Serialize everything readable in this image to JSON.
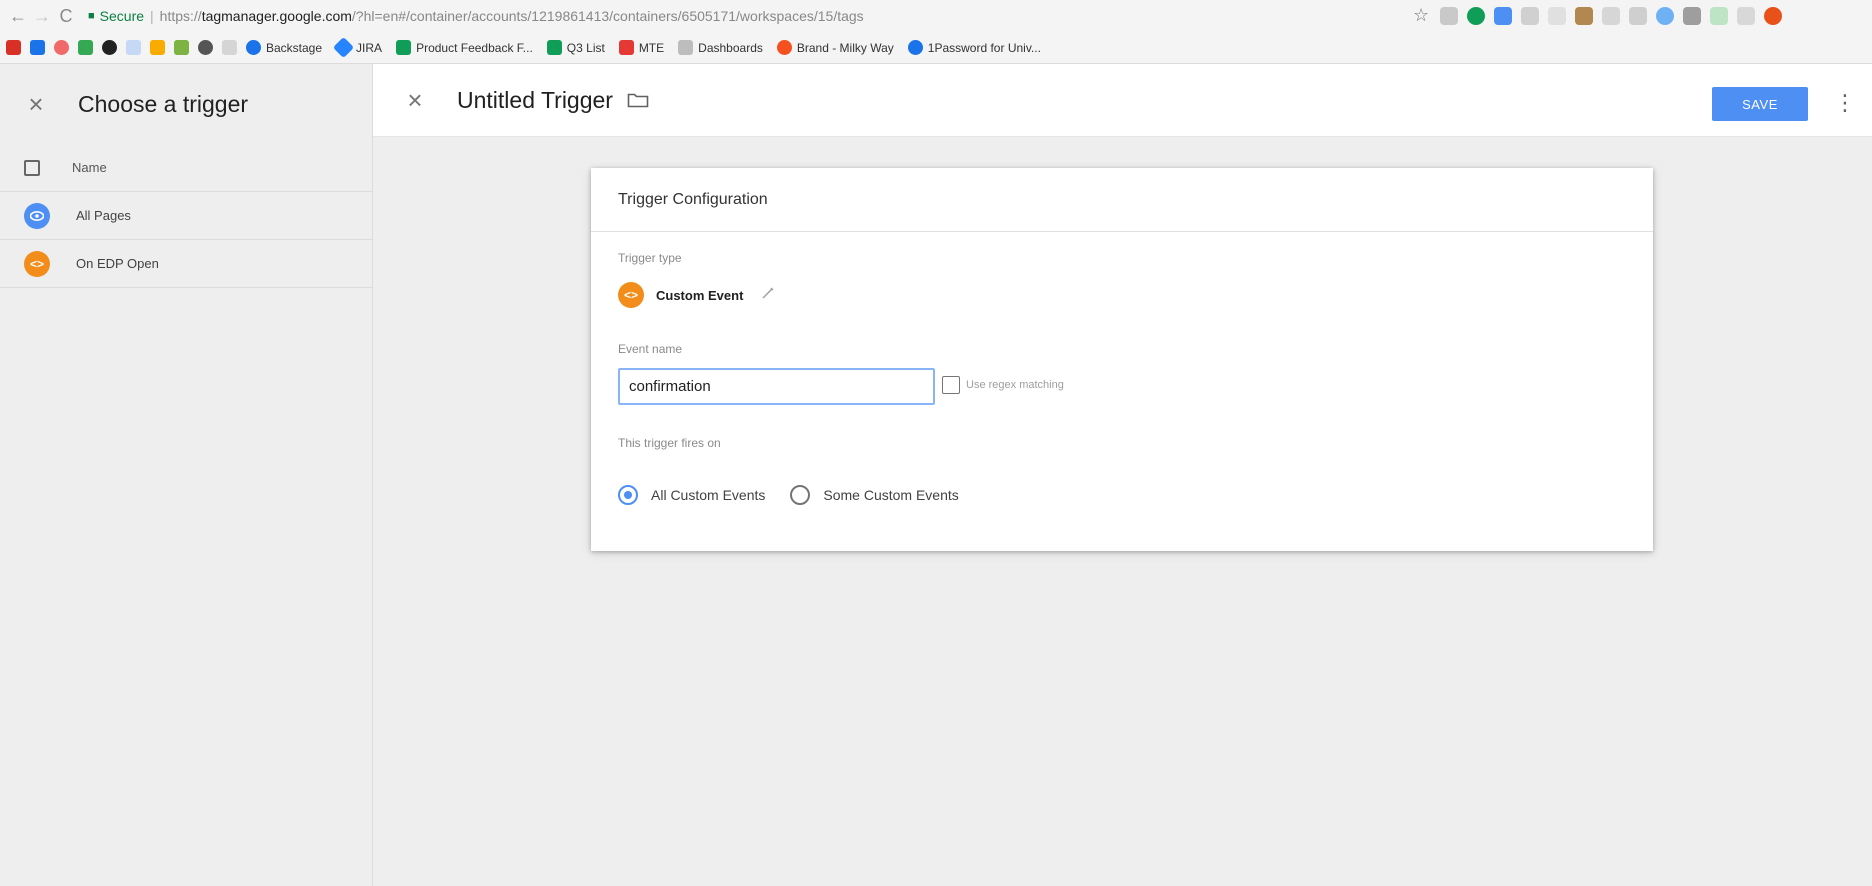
{
  "browser": {
    "back": "←",
    "forward": "→",
    "reload": "C",
    "secure_label": "Secure",
    "url_scheme": "https://",
    "url_host": "tagmanager.google.com",
    "url_path": "/?hl=en#/container/accounts/1219861413/containers/6505171/workspaces/15/tags",
    "bookmark_star": "☆"
  },
  "bookmarks": [
    {
      "label": "Backstage",
      "color": "#1a73e8"
    },
    {
      "label": "JIRA",
      "color": "#2684ff"
    },
    {
      "label": "Product Feedback F...",
      "color": "#0f9d58"
    },
    {
      "label": "Q3 List",
      "color": "#0f9d58"
    },
    {
      "label": "MTE",
      "color": "#e53935"
    },
    {
      "label": "Dashboards",
      "color": "#9e9e9e"
    },
    {
      "label": "Brand - Milky Way",
      "color": "#f4511e"
    },
    {
      "label": "1Password for Univ...",
      "color": "#1a73e8"
    }
  ],
  "left_panel": {
    "close_icon": "×",
    "title": "Choose a trigger",
    "header_label": "Name",
    "triggers": [
      {
        "label": "All Pages",
        "icon": "eye-icon",
        "color": "#4d8ff3"
      },
      {
        "label": "On EDP Open",
        "icon": "code-icon",
        "color": "#f28c1a"
      }
    ]
  },
  "editor": {
    "close_icon": "×",
    "title": "Untitled Trigger",
    "save_label": "SAVE",
    "more_icon": "⋮",
    "card": {
      "heading": "Trigger Configuration",
      "trigger_type_label": "Trigger type",
      "trigger_type_value": "Custom Event",
      "trigger_type_color": "#f28c1a",
      "event_name_label": "Event name",
      "event_name_value": "confirmation",
      "regex_label": "Use regex matching",
      "regex_checked": false,
      "fires_on_label": "This trigger fires on",
      "options": [
        {
          "label": "All Custom Events",
          "selected": true
        },
        {
          "label": "Some Custom Events",
          "selected": false
        }
      ]
    }
  },
  "colors": {
    "accent": "#4d8ff3",
    "custom_event_orange": "#f28c1a"
  }
}
